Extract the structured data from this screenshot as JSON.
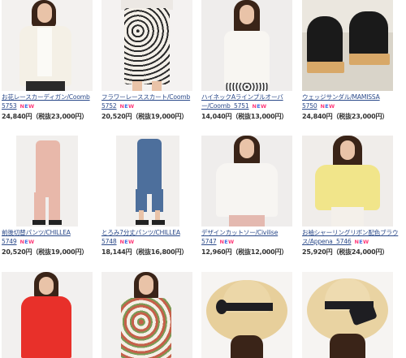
{
  "products": [
    {
      "name": "お花レースカーディガン/Coomb",
      "code": "5753",
      "new": "NEW",
      "price": "24,840円（税抜23,000円）"
    },
    {
      "name": "フラワーレーススカート/Coomb",
      "code": "5752",
      "new": "NEW",
      "price": "20,520円（税抜19,000円）"
    },
    {
      "name": "ハイネックAラインプルオーバー/Coomb",
      "code": "5751",
      "new": "NEW",
      "price": "14,040円（税抜13,000円）"
    },
    {
      "name": "ウェッジサンダル/MAMISSA",
      "code": "5750",
      "new": "NEW",
      "price": "24,840円（税抜23,000円）"
    },
    {
      "name": "前後切替パンツ/CHILLEA",
      "code": "5749",
      "new": "NEW",
      "price": "20,520円（税抜19,000円）"
    },
    {
      "name": "とろみ7分丈パンツ/CHILLEA",
      "code": "5748",
      "new": "NEW",
      "price": "18,144円（税抜16,800円）"
    },
    {
      "name": "デザインカットソー/Civilise",
      "code": "5747",
      "new": "NEW",
      "price": "12,960円（税抜12,000円）"
    },
    {
      "name": "お袖シャーリングリボン配色ブラウス/Appena",
      "code": "5746",
      "new": "NEW",
      "price": "25,920円（税抜24,000円）"
    },
    {
      "name": "",
      "code": "",
      "new": "",
      "price": ""
    },
    {
      "name": "",
      "code": "",
      "new": "",
      "price": ""
    },
    {
      "name": "",
      "code": "",
      "new": "",
      "price": ""
    },
    {
      "name": "",
      "code": "",
      "new": "",
      "price": ""
    }
  ],
  "image_icons": [
    "cardigan-photo-icon",
    "skirt-photo-icon",
    "pullover-photo-icon",
    "sandal-photo-icon",
    "pants-photo-icon",
    "cropped-pants-photo-icon",
    "cutsew-photo-icon",
    "blouse-photo-icon",
    "coat-photo-icon",
    "floral-cardigan-photo-icon",
    "straw-hat-photo-icon",
    "straw-hat-2-photo-icon"
  ],
  "colors": {
    "link": "#2b4a8a",
    "new_pink": "#ff3b7a",
    "new_blue": "#3f6fe0",
    "price": "#333333"
  }
}
